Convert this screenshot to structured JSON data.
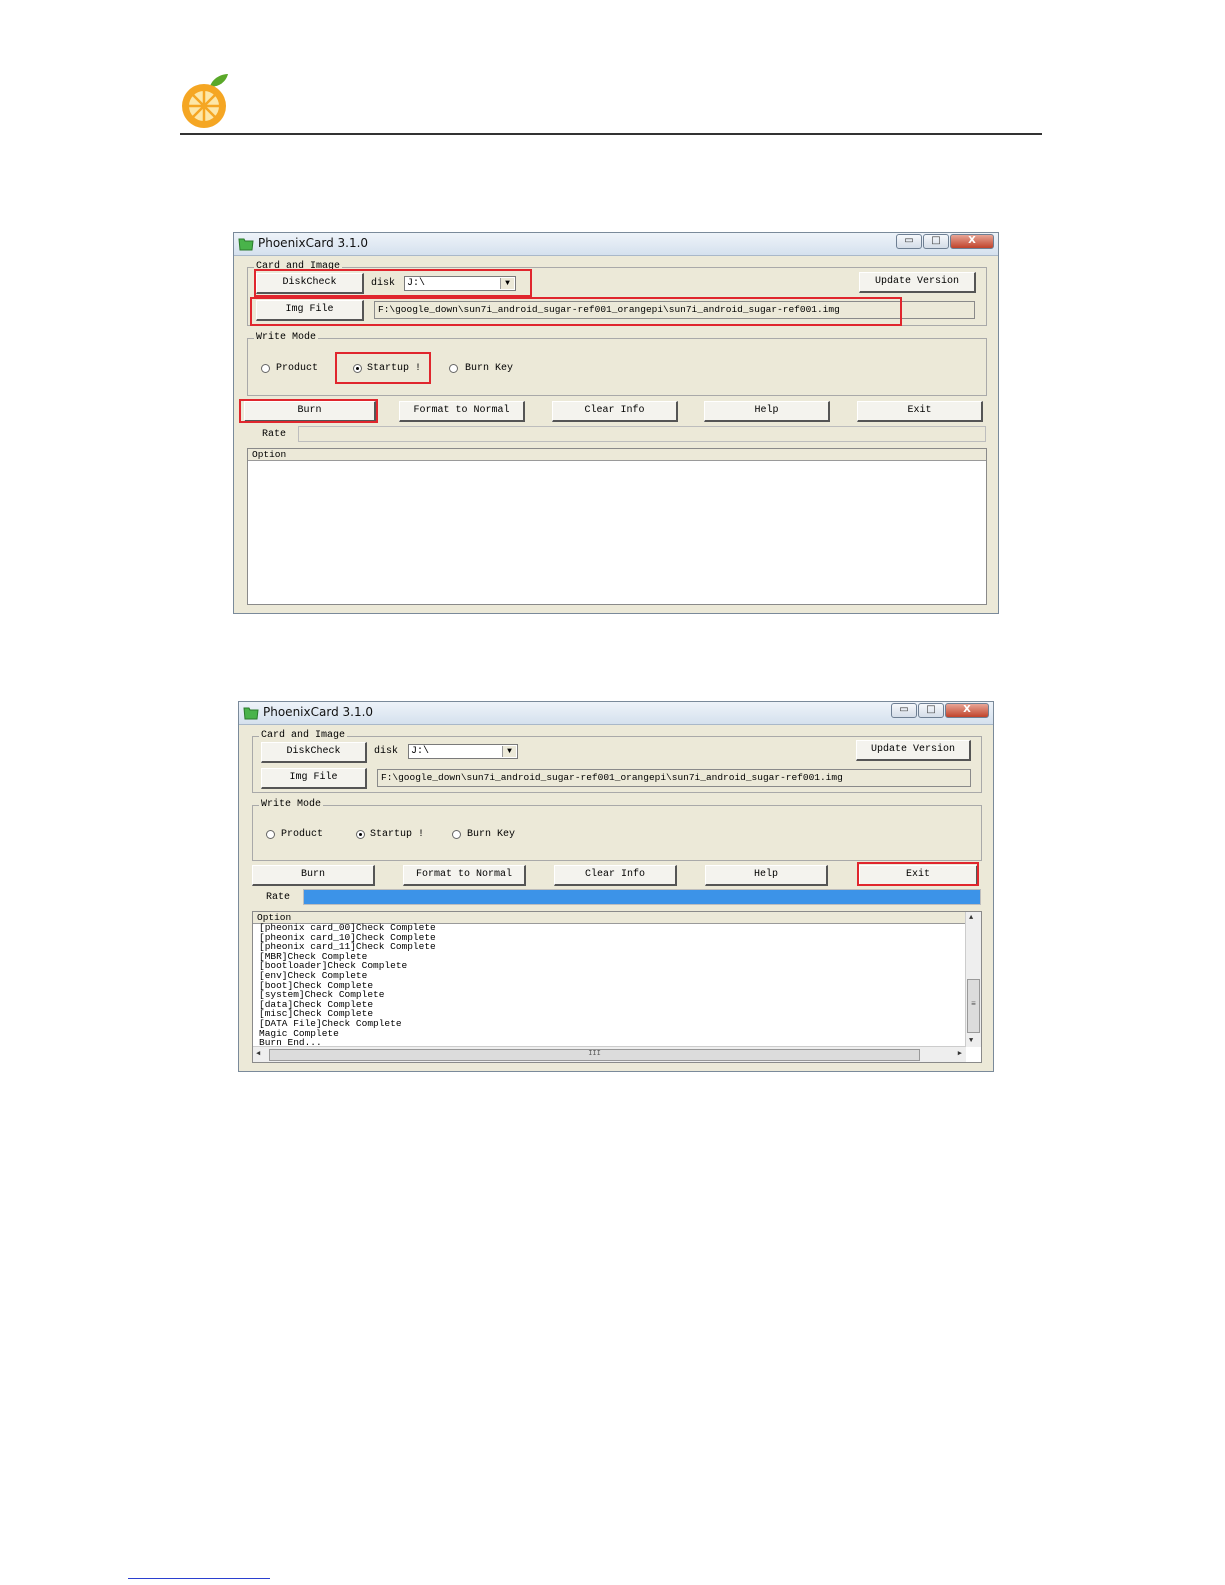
{
  "document": {
    "logo_icon": "orange-slice-logo-icon",
    "colors": {
      "logo_orange": "#f5a623",
      "logo_leaf": "#5aa829",
      "highlight_red": "#e0262d",
      "progress_blue": "#3c93e8"
    }
  },
  "app": {
    "title": "PhoenixCard 3.1.0",
    "window_icon": "folder-app-icon",
    "controls": {
      "minimize": "▭",
      "maximize": "□",
      "close": "X"
    },
    "group_card": "Card and Image",
    "diskcheck_label": "DiskCheck",
    "disk_label": "disk",
    "disk_value": "J:\\",
    "update_version_label": "Update Version",
    "img_file_label": "Img File",
    "img_path": "F:\\google_down\\sun7i_android_sugar-ref001_orangepi\\sun7i_android_sugar-ref001.img",
    "group_write_mode": "Write Mode",
    "mode_product": "Product",
    "mode_startup": "Startup !",
    "mode_burn_key": "Burn Key",
    "selected_mode": "Startup !",
    "burn_label": "Burn",
    "format_label": "Format to Normal",
    "clear_info_label": "Clear Info",
    "help_label": "Help",
    "exit_label": "Exit",
    "rate_label": "Rate",
    "option_header": "Option"
  },
  "screenshot1": {
    "progress": 0,
    "log_lines": []
  },
  "screenshot2": {
    "progress": 1.0,
    "log_lines": [
      "[pheonix card_00]Check Complete",
      "[pheonix card_10]Check Complete",
      "[pheonix card_11]Check Complete",
      "[MBR]Check Complete",
      "[bootloader]Check Complete",
      "[env]Check Complete",
      "[boot]Check Complete",
      "[system]Check Complete",
      "[data]Check Complete",
      "[misc]Check Complete",
      "[DATA File]Check Complete",
      "Magic Complete",
      "Burn End..."
    ],
    "scroll_glyphs": {
      "up": "▲",
      "down": "▼",
      "left": "◀",
      "right": "▶",
      "vgrip": "≡",
      "hgrip": "III"
    }
  }
}
